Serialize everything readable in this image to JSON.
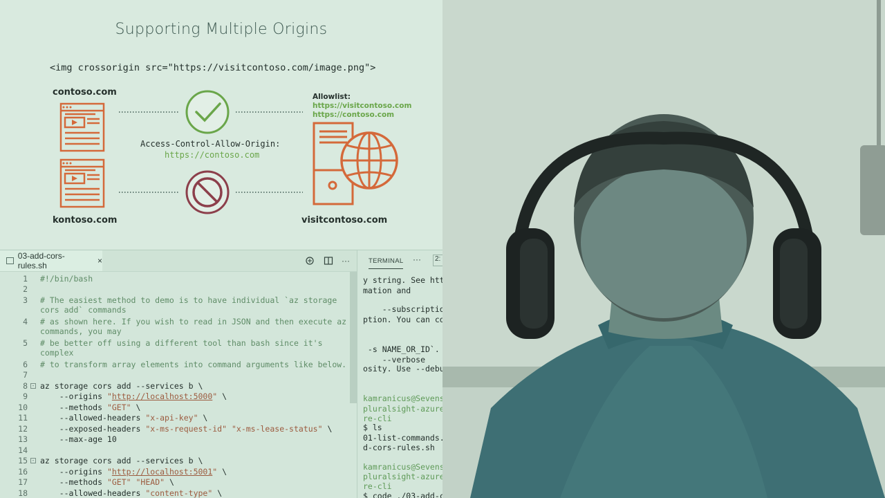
{
  "slide": {
    "title": "Supporting Multiple Origins",
    "code_line": "<img crossorigin src=\"https://visitcontoso.com/image.png\">",
    "left_top_site": "contoso.com",
    "left_bottom_site": "kontoso.com",
    "right_site": "visitcontoso.com",
    "header_name": "Access-Control-Allow-Origin:",
    "header_value": "https://contoso.com",
    "allowlist_title": "Allowlist:",
    "allowlist": [
      "https://visitcontoso.com",
      "https://contoso.com"
    ],
    "colors": {
      "accent": "#d4693a",
      "success": "#6aa64a",
      "deny": "#8c3f4b"
    }
  },
  "editor": {
    "tab_label": "03-add-cors-rules.sh",
    "tab_close": "×",
    "toolbar_more": "···"
  },
  "terminal": {
    "title": "TERMINAL",
    "more": "···",
    "selector": "2:",
    "lines": [
      "y string. See htt",
      "mation and",
      "",
      "    --subscriptio",
      "ption. You can co",
      "",
      "",
      " -s NAME_OR_ID`.",
      "    --verbose",
      "osity. Use --debu",
      "",
      "",
      "kamranicus@Sevens",
      "pluralsight-azure",
      "re-cli",
      "$ ls",
      "01-list-commands.",
      "d-cors-rules.sh",
      "",
      "kamranicus@Sevens",
      "pluralsight-azure",
      "re-cli",
      "$ code ./03-add-c"
    ]
  }
}
